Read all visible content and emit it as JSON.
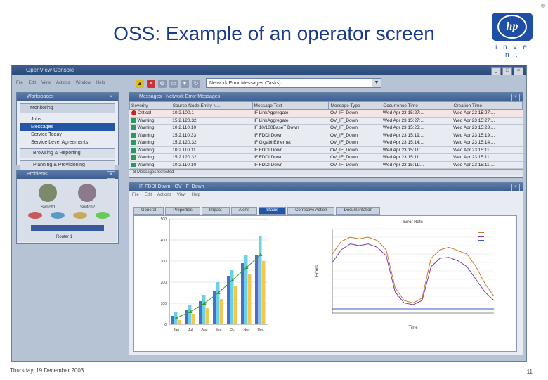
{
  "slide": {
    "title": "OSS: Example of an operator screen",
    "logo_text": "hp",
    "logo_tagline": "i n v e n t",
    "date": "Thursday, 19 December 2003",
    "page_number": "11",
    "corner_mark": "®"
  },
  "app": {
    "title": "OpenView Console",
    "menu": [
      "File",
      "Edit",
      "View",
      "Actions",
      "Window",
      "Help"
    ],
    "combo_value": "Network Error Messages (Tasks)",
    "win_buttons": [
      "_",
      "□",
      "×"
    ]
  },
  "workspaces": {
    "header": "Workspaces",
    "group": "Monitoring",
    "items": [
      "Jobs",
      "Messages",
      "Service Today",
      "Service Level Agreements"
    ],
    "bottom_groups": [
      "Browsing & Reporting",
      "Planning & Provisioning"
    ]
  },
  "problems": {
    "header": "Problems",
    "labels": [
      "Switch1",
      "Switch2"
    ],
    "status": "Router 1"
  },
  "messages": {
    "header": "Messages - Network Error Messages",
    "columns": [
      "Severity",
      "Source Node Entity N...",
      "Message Text",
      "Message Type",
      "Occurrence Time",
      "Creation Time"
    ],
    "rows": [
      {
        "severity": "Critical",
        "sev_color": "#cc2222",
        "node": "10.2.100.1",
        "text": "IF LinkAggregate",
        "type": "OV_IF_Down",
        "occ": "Wed Apr 23 15:27:...",
        "created": "Wed Apr 23 15:27:..."
      },
      {
        "severity": "Warning",
        "sev_color": "#2a9a5a",
        "node": "15.2.120.32",
        "text": "IF LinkAggregate",
        "type": "OV_IF_Down",
        "occ": "Wed Apr 23 15:27:...",
        "created": "Wed Apr 23 15:27:..."
      },
      {
        "severity": "Warning",
        "sev_color": "#2a9a5a",
        "node": "10.2.110.10",
        "text": "IF 10/100BaseT Down",
        "type": "OV_IF_Down",
        "occ": "Wed Apr 23 15:23:...",
        "created": "Wed Apr 23 15:23:..."
      },
      {
        "severity": "Warning",
        "sev_color": "#2a9a5a",
        "node": "15.2.110.33",
        "text": "IF FDDI Down",
        "type": "OV_IF_Down",
        "occ": "Wed Apr 23 15:19:...",
        "created": "Wed Apr 23 15:19:..."
      },
      {
        "severity": "Warning",
        "sev_color": "#2a9a5a",
        "node": "15.2.120.32",
        "text": "IF GigabitEthernet",
        "type": "OV_IF_Down",
        "occ": "Wed Apr 23 15:14:...",
        "created": "Wed Apr 23 15:14:..."
      },
      {
        "severity": "Warning",
        "sev_color": "#2a9a5a",
        "node": "10.2.110.11",
        "text": "IF FDDI Down",
        "type": "OV_IF_Down",
        "occ": "Wed Apr 23 15:11:...",
        "created": "Wed Apr 23 15:11:..."
      },
      {
        "severity": "Warning",
        "sev_color": "#2a9a5a",
        "node": "15.2.120.32",
        "text": "IF FDDI Down",
        "type": "OV_IF_Down",
        "occ": "Wed Apr 23 15:11:...",
        "created": "Wed Apr 23 15:11:..."
      },
      {
        "severity": "Warning",
        "sev_color": "#2a9a5a",
        "node": "10.2.110.10",
        "text": "IF FDDI Down",
        "type": "OV_IF_Down",
        "occ": "Wed Apr 23 15:11:...",
        "created": "Wed Apr 23 15:11:..."
      }
    ],
    "status": "8 Messages Selected"
  },
  "detail": {
    "header": "IF FDDI Down - OV_IF_Down",
    "menu": [
      "File",
      "Edit",
      "Actions",
      "View",
      "Help"
    ],
    "tabs": [
      "General",
      "Properties",
      "Impact",
      "Alerts",
      "Status",
      "Corrective Action",
      "Documentation"
    ],
    "active_tab": "Status"
  },
  "chart_data": [
    {
      "type": "bar",
      "title": "",
      "categories": [
        "Jun",
        "Jul",
        "Aug",
        "Sep",
        "Oct",
        "Nov",
        "Dec"
      ],
      "series": [
        {
          "values": [
            40,
            70,
            110,
            160,
            230,
            290,
            330
          ],
          "color": "#4a6fc8"
        },
        {
          "values": [
            60,
            90,
            140,
            200,
            260,
            330,
            420
          ],
          "color": "#6ad0e8"
        },
        {
          "values": [
            20,
            50,
            80,
            120,
            180,
            240,
            300
          ],
          "color": "#f0c850"
        }
      ],
      "line_values": [
        30,
        60,
        100,
        150,
        210,
        270,
        330
      ],
      "line_color": "#3a9a3a",
      "ylim": [
        0,
        500
      ],
      "yticks": [
        0,
        100,
        200,
        300,
        400,
        500
      ],
      "grid": true
    },
    {
      "type": "line",
      "title": "Error Rate",
      "xlabel": "Time",
      "ylabel": "Errors",
      "series": [
        {
          "values": [
            0.7,
            0.85,
            0.9,
            0.88,
            0.9,
            0.86,
            0.75,
            0.3,
            0.15,
            0.12,
            0.18,
            0.65,
            0.75,
            0.78,
            0.74,
            0.7,
            0.55,
            0.35,
            0.2
          ],
          "color": "#c87a2a"
        },
        {
          "values": [
            0.6,
            0.75,
            0.82,
            0.8,
            0.82,
            0.78,
            0.68,
            0.25,
            0.12,
            0.1,
            0.15,
            0.55,
            0.65,
            0.66,
            0.62,
            0.55,
            0.4,
            0.25,
            0.15
          ],
          "color": "#7a3aa8"
        },
        {
          "values": [
            0.05,
            0.05,
            0.05,
            0.05,
            0.05,
            0.05,
            0.05,
            0.05,
            0.05,
            0.05,
            0.05,
            0.05,
            0.05,
            0.05,
            0.05,
            0.05,
            0.05,
            0.05,
            0.05
          ],
          "color": "#3a5ac8"
        }
      ],
      "ylim": [
        0,
        1
      ],
      "legend_position": "top-right"
    }
  ]
}
